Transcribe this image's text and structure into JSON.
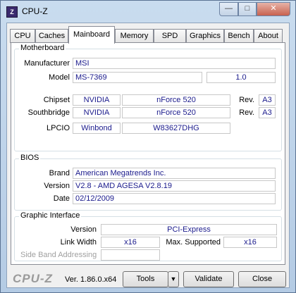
{
  "window": {
    "title": "CPU-Z",
    "app_icon_glyph": "Z",
    "controls": {
      "min": "—",
      "max": "□",
      "close": "✕"
    }
  },
  "tabs": [
    "CPU",
    "Caches",
    "Mainboard",
    "Memory",
    "SPD",
    "Graphics",
    "Bench",
    "About"
  ],
  "active_tab": "Mainboard",
  "motherboard": {
    "title": "Motherboard",
    "manufacturer_label": "Manufacturer",
    "manufacturer": "MSI",
    "model_label": "Model",
    "model": "MS-7369",
    "model_rev": "1.0",
    "chipset_label": "Chipset",
    "chipset_vendor": "NVIDIA",
    "chipset_name": "nForce 520",
    "chipset_rev_label": "Rev.",
    "chipset_rev": "A3",
    "southbridge_label": "Southbridge",
    "southbridge_vendor": "NVIDIA",
    "southbridge_name": "nForce 520",
    "southbridge_rev_label": "Rev.",
    "southbridge_rev": "A3",
    "lpcio_label": "LPCIO",
    "lpcio_vendor": "Winbond",
    "lpcio_name": "W83627DHG"
  },
  "bios": {
    "title": "BIOS",
    "brand_label": "Brand",
    "brand": "American Megatrends Inc.",
    "version_label": "Version",
    "version": "V2.8 - AMD AGESA V2.8.19",
    "date_label": "Date",
    "date": "02/12/2009"
  },
  "graphic_interface": {
    "title": "Graphic Interface",
    "version_label": "Version",
    "version": "PCI-Express",
    "link_width_label": "Link Width",
    "link_width": "x16",
    "max_supported_label": "Max. Supported",
    "max_supported": "x16",
    "side_band_label": "Side Band Addressing",
    "side_band": ""
  },
  "footer": {
    "logo": "CPU-Z",
    "version": "Ver. 1.86.0.x64",
    "tools_label": "Tools",
    "tools_arrow": "▼",
    "validate_label": "Validate",
    "close_label": "Close"
  }
}
